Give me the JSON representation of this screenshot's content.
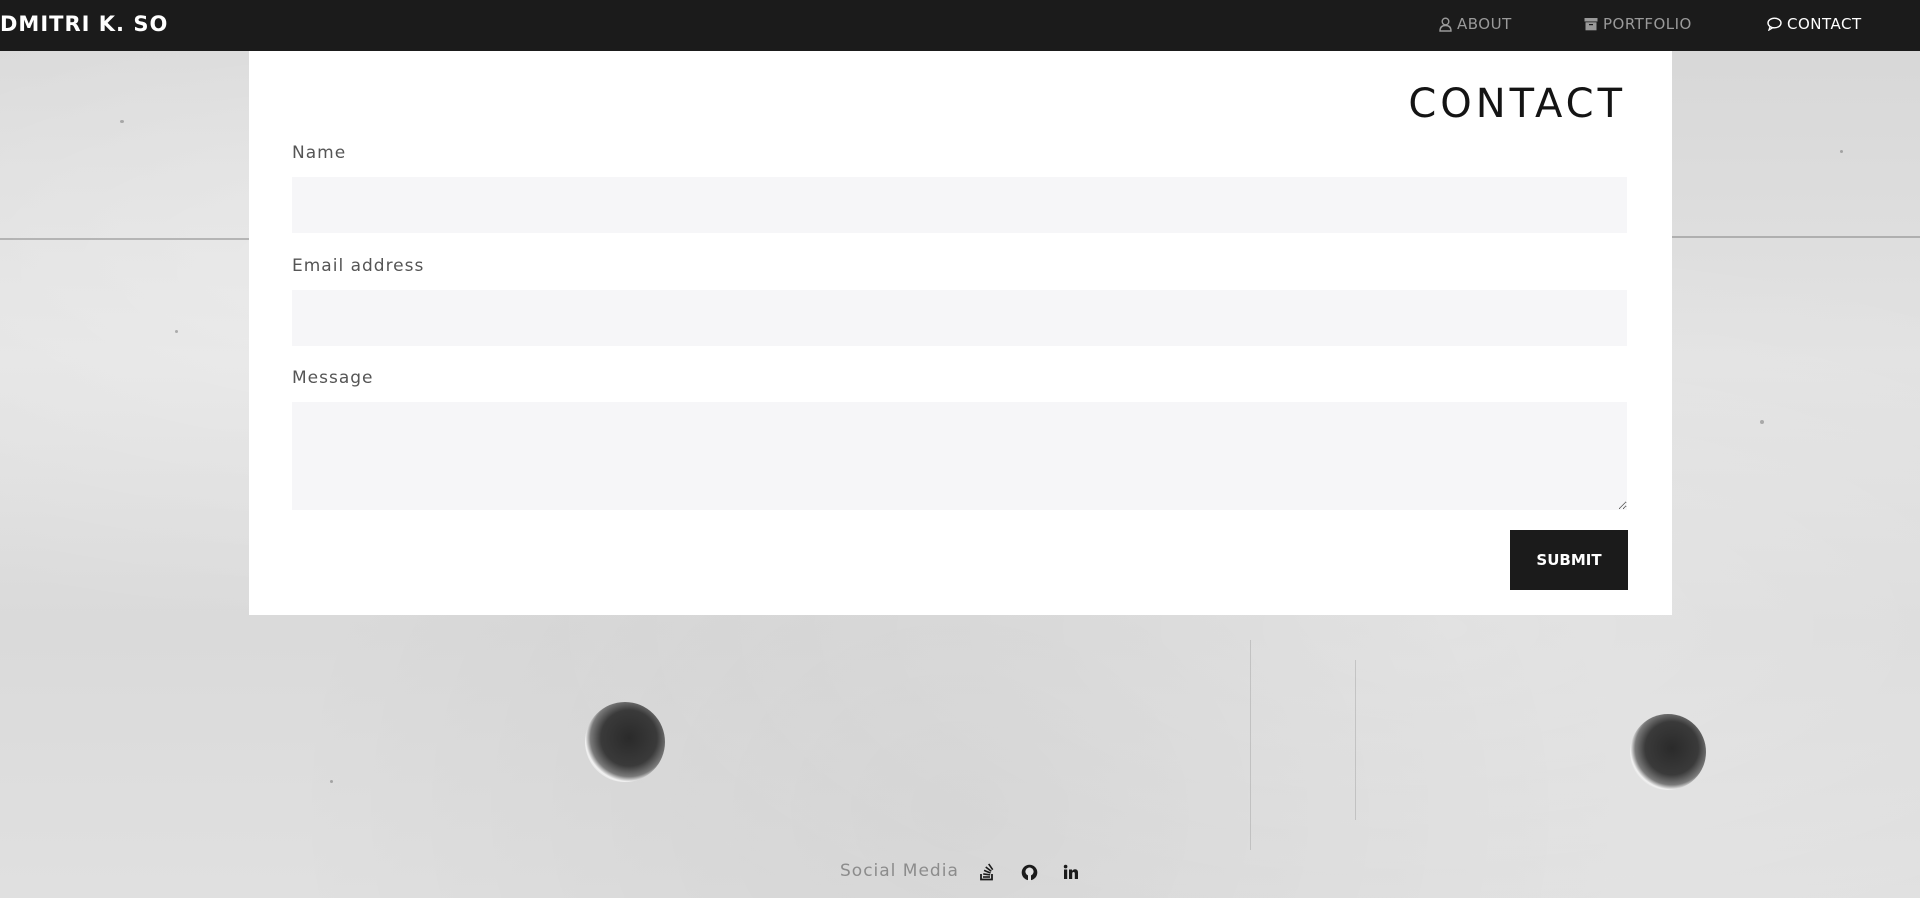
{
  "brand": "DMITRI K. SO",
  "nav": {
    "about": "ABOUT",
    "portfolio": "PORTFOLIO",
    "contact": "CONTACT"
  },
  "page_title": "CONTACT",
  "form": {
    "name_label": "Name",
    "name_value": "",
    "email_label": "Email address",
    "email_value": "",
    "message_label": "Message",
    "message_value": "",
    "submit_label": "SUBMIT"
  },
  "footer": {
    "label": "Social Media",
    "icons": [
      "stack-overflow-icon",
      "github-icon",
      "linkedin-icon"
    ]
  },
  "colors": {
    "navbar": "#1b1b1b",
    "nav_inactive": "#9a9a9a",
    "nav_active": "#ffffff",
    "input_bg": "#f6f6f8",
    "button_bg": "#1b1b1b"
  }
}
